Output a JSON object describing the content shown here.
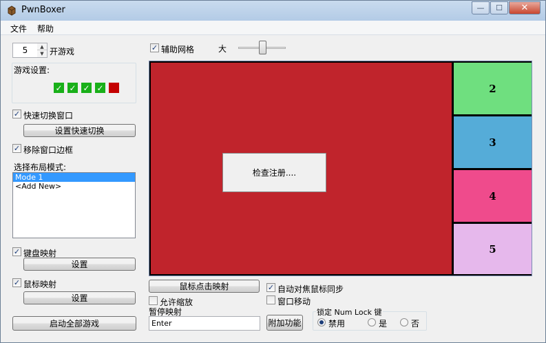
{
  "window": {
    "title": "PwnBoxer",
    "minimize": "—",
    "maximize": "☐",
    "close": "✕"
  },
  "menu": {
    "file": "文件",
    "help": "帮助"
  },
  "left": {
    "game_count": "5",
    "open_games_label": "开游戏",
    "game_settings_label": "游戏设置:",
    "game_status": [
      {
        "state": "on",
        "glyph": "✓"
      },
      {
        "state": "on",
        "glyph": "✓"
      },
      {
        "state": "on",
        "glyph": "✓"
      },
      {
        "state": "on",
        "glyph": "✓"
      },
      {
        "state": "off",
        "glyph": ""
      }
    ],
    "quick_switch": {
      "label": "快速切换窗口",
      "checked": true,
      "glyph": "✓",
      "button": "设置快速切换"
    },
    "remove_border": {
      "label": "移除窗口边框",
      "checked": true,
      "glyph": "✓"
    },
    "layout_mode_label": "选择布局模式:",
    "layout_modes": [
      "Mode 1",
      "<Add New>"
    ],
    "keyboard_map": {
      "label": "键盘映射",
      "checked": true,
      "glyph": "✓",
      "button": "设置"
    },
    "mouse_map": {
      "label": "鼠标映射",
      "checked": true,
      "glyph": "✓",
      "button": "设置"
    },
    "launch_all": "启动全部游戏"
  },
  "top": {
    "grid": {
      "label": "辅助网格",
      "checked": true,
      "glyph": "✓"
    },
    "size_label": "大"
  },
  "layout": {
    "check_register": "检查注册....",
    "zones": [
      {
        "label": "2",
        "color": "#6fdf7f"
      },
      {
        "label": "3",
        "color": "#55acd8"
      },
      {
        "label": "4",
        "color": "#ef4b8c"
      },
      {
        "label": "5",
        "color": "#e6b8ec"
      }
    ],
    "main_color": "#c0242c"
  },
  "bottom": {
    "mouse_click_map": "鼠标点击映射",
    "allow_zoom": {
      "label": "允许缩放",
      "checked": false
    },
    "pause_map_label": "暂停映射",
    "pause_map_value": "Enter",
    "auto_focus_sync": {
      "label": "自动对焦鼠标同步",
      "checked": true,
      "glyph": "✓"
    },
    "window_move": {
      "label": "窗口移动",
      "checked": false
    },
    "extra_functions": "附加功能",
    "numlock": {
      "title": "锁定 Num Lock 键",
      "options": [
        {
          "label": "禁用",
          "selected": true
        },
        {
          "label": "是",
          "selected": false
        },
        {
          "label": "否",
          "selected": false
        }
      ]
    }
  }
}
